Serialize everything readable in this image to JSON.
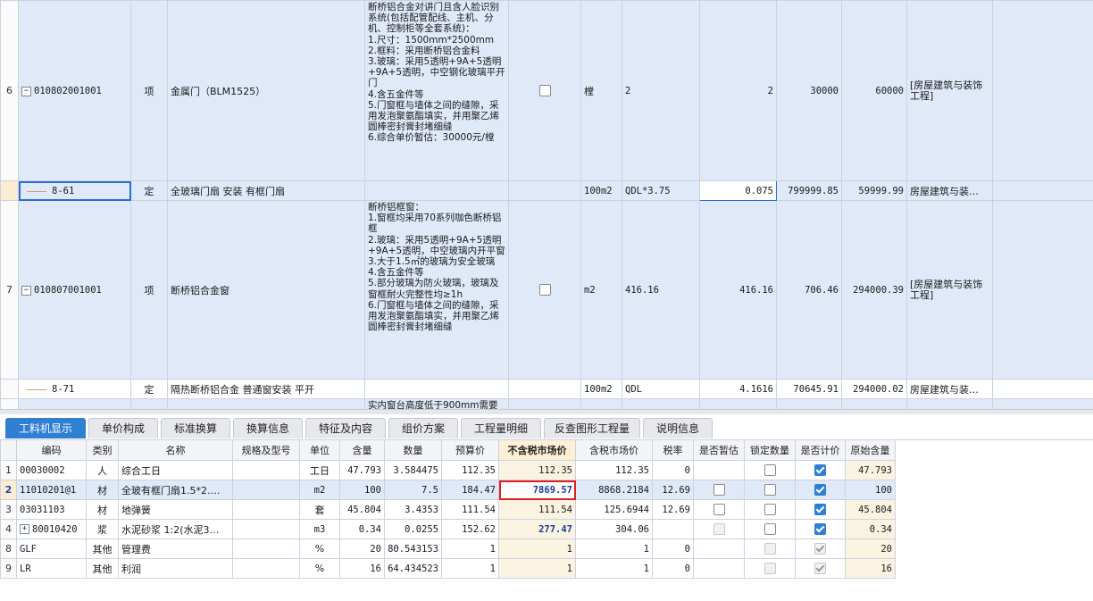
{
  "upper": {
    "row6": {
      "num": "6",
      "code": "010802001001",
      "type": "项",
      "name": "金属门（BLM1525）",
      "desc": "断桥铝合金对讲门且含人脸识别系统(包括配管配线、主机、分机、控制柜等全套系统)：\n1.尺寸：1500mm*2500mm\n2.框料：采用断桥铝合金料\n3.玻璃：采用5透明+9A+5透明+9A+5透明，中空钢化玻璃平开门\n4.含五金件等\n5.门窗框与墙体之间的缝隙，采用发泡聚氨酯填实，并用聚乙烯圆棒密封膏封堵细缝\n6.综合单价暂估：30000元/樘",
      "unit": "樘",
      "expr": "2",
      "qty": "2",
      "price": "30000",
      "total": "60000",
      "major": "[房屋建筑与装饰工程]"
    },
    "sub861": {
      "code": "8-61",
      "type": "定",
      "name": "全玻璃门扇 安装 有框门扇",
      "unit": "100m2",
      "expr": "QDL*3.75",
      "qty": "0.075",
      "price": "799999.85",
      "total": "59999.99",
      "major": "房屋建筑与装…"
    },
    "row7": {
      "num": "7",
      "code": "010807001001",
      "type": "项",
      "name": "断桥铝合金窗",
      "desc": "断桥铝框窗：\n1.窗框均采用70系列咖色断桥铝框\n2.玻璃：采用5透明+9A+5透明+9A+5透明，中空玻璃内开平窗\n3.大于1.5㎡的玻璃为安全玻璃\n4.含五金件等\n5.部分玻璃为防火玻璃，玻璃及窗框耐火完整性均≥1h\n6.门窗框与墙体之间的缝隙，采用发泡聚氨酯填实，并用聚乙烯圆棒密封膏封堵细缝",
      "unit": "m2",
      "expr": "416.16",
      "qty": "416.16",
      "price": "706.46",
      "total": "294000.39",
      "major": "[房屋建筑与装饰工程]"
    },
    "sub871": {
      "code": "8-71",
      "type": "定",
      "name": "隔热断桥铝合金 普通窗安装 平开",
      "unit": "100m2",
      "expr": "QDL",
      "qty": "4.1616",
      "price": "70645.91",
      "total": "294000.02",
      "major": "房屋建筑与装…"
    },
    "partial": "实内窗台高度低于900mm需要"
  },
  "tabs": [
    "工料机显示",
    "单价构成",
    "标准换算",
    "换算信息",
    "特征及内容",
    "组价方案",
    "工程量明细",
    "反查图形工程量",
    "说明信息"
  ],
  "lower": {
    "headers": [
      "编码",
      "类别",
      "名称",
      "规格及型号",
      "单位",
      "含量",
      "数量",
      "预算价",
      "不含税市场价",
      "含税市场价",
      "税率",
      "是否暂估",
      "锁定数量",
      "是否计价",
      "原始含量"
    ],
    "rows": [
      {
        "idx": "1",
        "code": "00030002",
        "cat": "人",
        "name": "综合工日",
        "spec": "",
        "unit": "工日",
        "content": "47.793",
        "qty": "3.584475",
        "budget": "112.35",
        "market": "112.35",
        "taxmarket": "112.35",
        "rate": "0",
        "orig": "47.793"
      },
      {
        "idx": "2",
        "code": "11010201@1",
        "cat": "材",
        "name": "全玻有框门扇1.5*2.…",
        "spec": "",
        "unit": "m2",
        "content": "100",
        "qty": "7.5",
        "budget": "184.47",
        "market": "7869.57",
        "taxmarket": "8868.2184",
        "rate": "12.69",
        "orig": "100"
      },
      {
        "idx": "3",
        "code": "03031103",
        "cat": "材",
        "name": "地弹簧",
        "spec": "",
        "unit": "套",
        "content": "45.804",
        "qty": "3.4353",
        "budget": "111.54",
        "market": "111.54",
        "taxmarket": "125.6944",
        "rate": "12.69",
        "orig": "45.804"
      },
      {
        "idx": "4",
        "code": "80010420",
        "cat": "浆",
        "name": "水泥砂浆 1:2(水泥3…",
        "spec": "",
        "unit": "m3",
        "content": "0.34",
        "qty": "0.0255",
        "budget": "152.62",
        "market": "277.47",
        "taxmarket": "304.06",
        "rate": "",
        "orig": "0.34"
      },
      {
        "idx": "8",
        "code": "GLF",
        "cat": "其他",
        "name": "管理费",
        "spec": "",
        "unit": "%",
        "content": "20",
        "qty": "80.543153",
        "budget": "1",
        "market": "1",
        "taxmarket": "1",
        "rate": "0",
        "orig": "20"
      },
      {
        "idx": "9",
        "code": "LR",
        "cat": "其他",
        "name": "利润",
        "spec": "",
        "unit": "%",
        "content": "16",
        "qty": "64.434523",
        "budget": "1",
        "market": "1",
        "taxmarket": "1",
        "rate": "0",
        "orig": "16"
      }
    ]
  },
  "icons": {
    "expand": "plus-icon",
    "collapse": "minus-icon",
    "check": "checkbox-icon"
  },
  "colors": {
    "accent": "#2f7fd3",
    "row_highlight": "#dfe9f8",
    "market_column": "#fbf3e1",
    "red_box": "#e02020"
  }
}
